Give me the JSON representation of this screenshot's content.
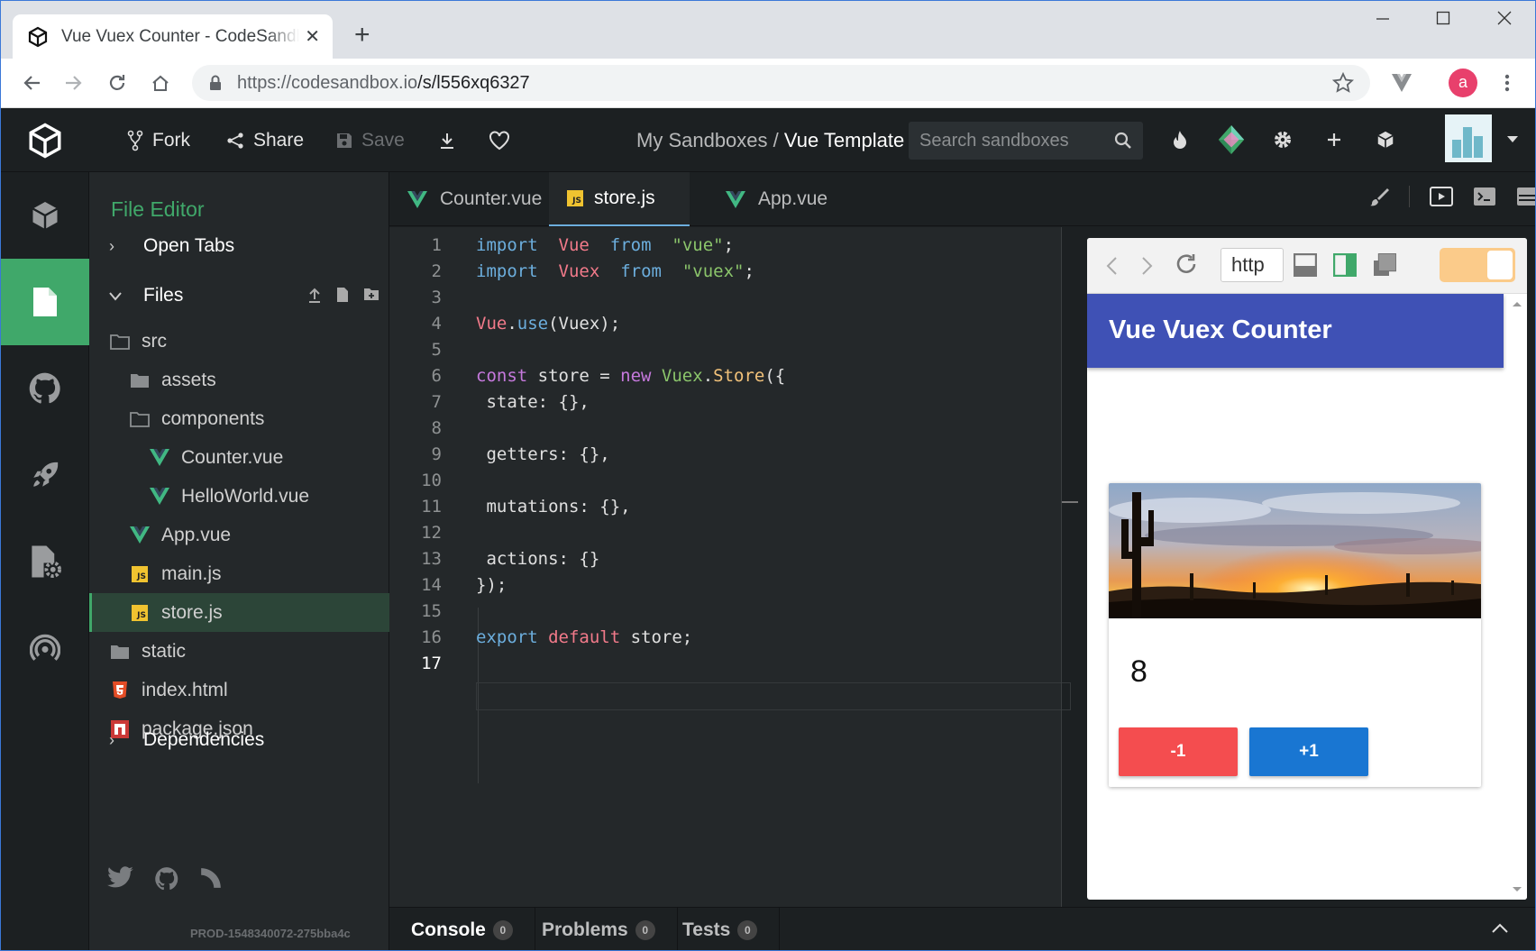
{
  "browser": {
    "tab_title": "Vue Vuex Counter - CodeSandbox",
    "close_glyph": "✕",
    "new_tab_glyph": "+",
    "url_host": "https://codesandbox.io",
    "url_path": "/s/l556xq6327",
    "avatar_letter": "a"
  },
  "header": {
    "fork": "Fork",
    "share": "Share",
    "save": "Save",
    "crumb_parent": "My Sandboxes",
    "crumb_sep": " / ",
    "crumb_current": "Vue Template",
    "search_placeholder": "Search sandboxes"
  },
  "sidebar": {
    "title": "File Editor",
    "open_tabs": "Open Tabs",
    "files": "Files",
    "dependencies": "Dependencies",
    "build": "PROD-1548340072-275bba4c",
    "tree": [
      {
        "label": "src",
        "indent": 0,
        "icon": "folder-open"
      },
      {
        "label": "assets",
        "indent": 1,
        "icon": "folder"
      },
      {
        "label": "components",
        "indent": 1,
        "icon": "folder-open"
      },
      {
        "label": "Counter.vue",
        "indent": 2,
        "icon": "vue"
      },
      {
        "label": "HelloWorld.vue",
        "indent": 2,
        "icon": "vue"
      },
      {
        "label": "App.vue",
        "indent": 1,
        "icon": "vue"
      },
      {
        "label": "main.js",
        "indent": 1,
        "icon": "js"
      },
      {
        "label": "store.js",
        "indent": 1,
        "icon": "js",
        "selected": true
      },
      {
        "label": "static",
        "indent": 0,
        "icon": "folder"
      },
      {
        "label": "index.html",
        "indent": 0,
        "icon": "html"
      },
      {
        "label": "package.json",
        "indent": 0,
        "icon": "npm"
      }
    ]
  },
  "editor": {
    "tabs": [
      {
        "label": "Counter.vue",
        "icon": "vue"
      },
      {
        "label": "store.js",
        "icon": "js",
        "active": true
      },
      {
        "label": "App.vue",
        "icon": "vue"
      }
    ],
    "js_icon_text": "JS",
    "current_line": 17,
    "lines": [
      [
        [
          "kw",
          "import"
        ],
        [
          "",
          "  "
        ],
        [
          "vr",
          "Vue"
        ],
        [
          "",
          "  "
        ],
        [
          "kw",
          "from"
        ],
        [
          "",
          "  "
        ],
        [
          "st",
          "\"vue\""
        ],
        [
          "",
          ";"
        ]
      ],
      [
        [
          "kw",
          "import"
        ],
        [
          "",
          "  "
        ],
        [
          "vr",
          "Vuex"
        ],
        [
          "",
          "  "
        ],
        [
          "kw",
          "from"
        ],
        [
          "",
          "  "
        ],
        [
          "st",
          "\"vuex\""
        ],
        [
          "",
          ";"
        ]
      ],
      [],
      [
        [
          "vr",
          "Vue"
        ],
        [
          "",
          "."
        ],
        [
          "fn",
          "use"
        ],
        [
          "",
          "(Vuex);"
        ]
      ],
      [],
      [
        [
          "kp",
          "const"
        ],
        [
          "",
          " store = "
        ],
        [
          "kp",
          "new"
        ],
        [
          "",
          ""
        ],
        [
          "cls",
          " Vuex"
        ],
        [
          "",
          "."
        ],
        [
          "mt",
          "Store"
        ],
        [
          "",
          "({"
        ]
      ],
      [
        [
          "",
          " state: {},"
        ]
      ],
      [],
      [
        [
          "",
          " getters: {},"
        ]
      ],
      [],
      [
        [
          "",
          " mutations: {},"
        ]
      ],
      [],
      [
        [
          "",
          " actions: {}"
        ]
      ],
      [
        [
          "",
          "});"
        ]
      ],
      [],
      [
        [
          "kw",
          "export"
        ],
        [
          "",
          " "
        ],
        [
          "vr",
          "default"
        ],
        [
          "",
          " store;"
        ]
      ],
      []
    ]
  },
  "preview": {
    "address": "http",
    "app_title": "Vue Vuex Counter",
    "count": "8",
    "decrement": "-1",
    "increment": "+1",
    "colors": {
      "appbar": "#3f51b5",
      "decrement": "#f44d4f",
      "increment": "#1976d2",
      "toggle": "#fbcb8a"
    }
  },
  "bottom": {
    "console": "Console",
    "console_count": "0",
    "problems": "Problems",
    "problems_count": "0",
    "tests": "Tests",
    "tests_count": "0"
  }
}
